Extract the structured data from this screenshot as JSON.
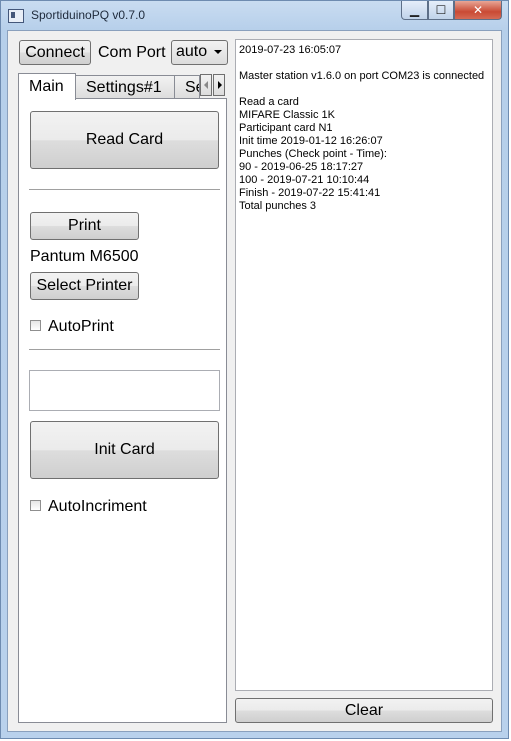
{
  "window": {
    "title": "SportiduinoPQ v0.7.0",
    "minimize_glyph": "▁",
    "maximize_glyph": "☐",
    "close_glyph": "✕"
  },
  "toolbar": {
    "connect_label": "Connect",
    "comport_label": "Com Port",
    "comport_value": "auto"
  },
  "tabs": [
    {
      "label": "Main"
    },
    {
      "label": "Settings#1"
    },
    {
      "label": "Se"
    }
  ],
  "main": {
    "read_card_label": "Read Card",
    "print_label": "Print",
    "printer_name": "Pantum M6500",
    "select_printer_label": "Select Printer",
    "autoprint_label": "AutoPrint",
    "card_number_value": "",
    "init_card_label": "Init Card",
    "autoincrement_label": "AutoIncriment"
  },
  "log": {
    "lines": [
      "2019-07-23 16:05:07",
      "",
      "Master station v1.6.0 on port COM23 is connected",
      "",
      "Read a card",
      "MIFARE Classic 1K",
      "Participant card N1",
      "Init time 2019-01-12 16:26:07",
      "Punches (Check point - Time):",
      "90 - 2019-06-25 18:17:27",
      "100 - 2019-07-21 10:10:44",
      "Finish - 2019-07-22 15:41:41",
      "Total punches 3"
    ]
  },
  "clear_label": "Clear"
}
